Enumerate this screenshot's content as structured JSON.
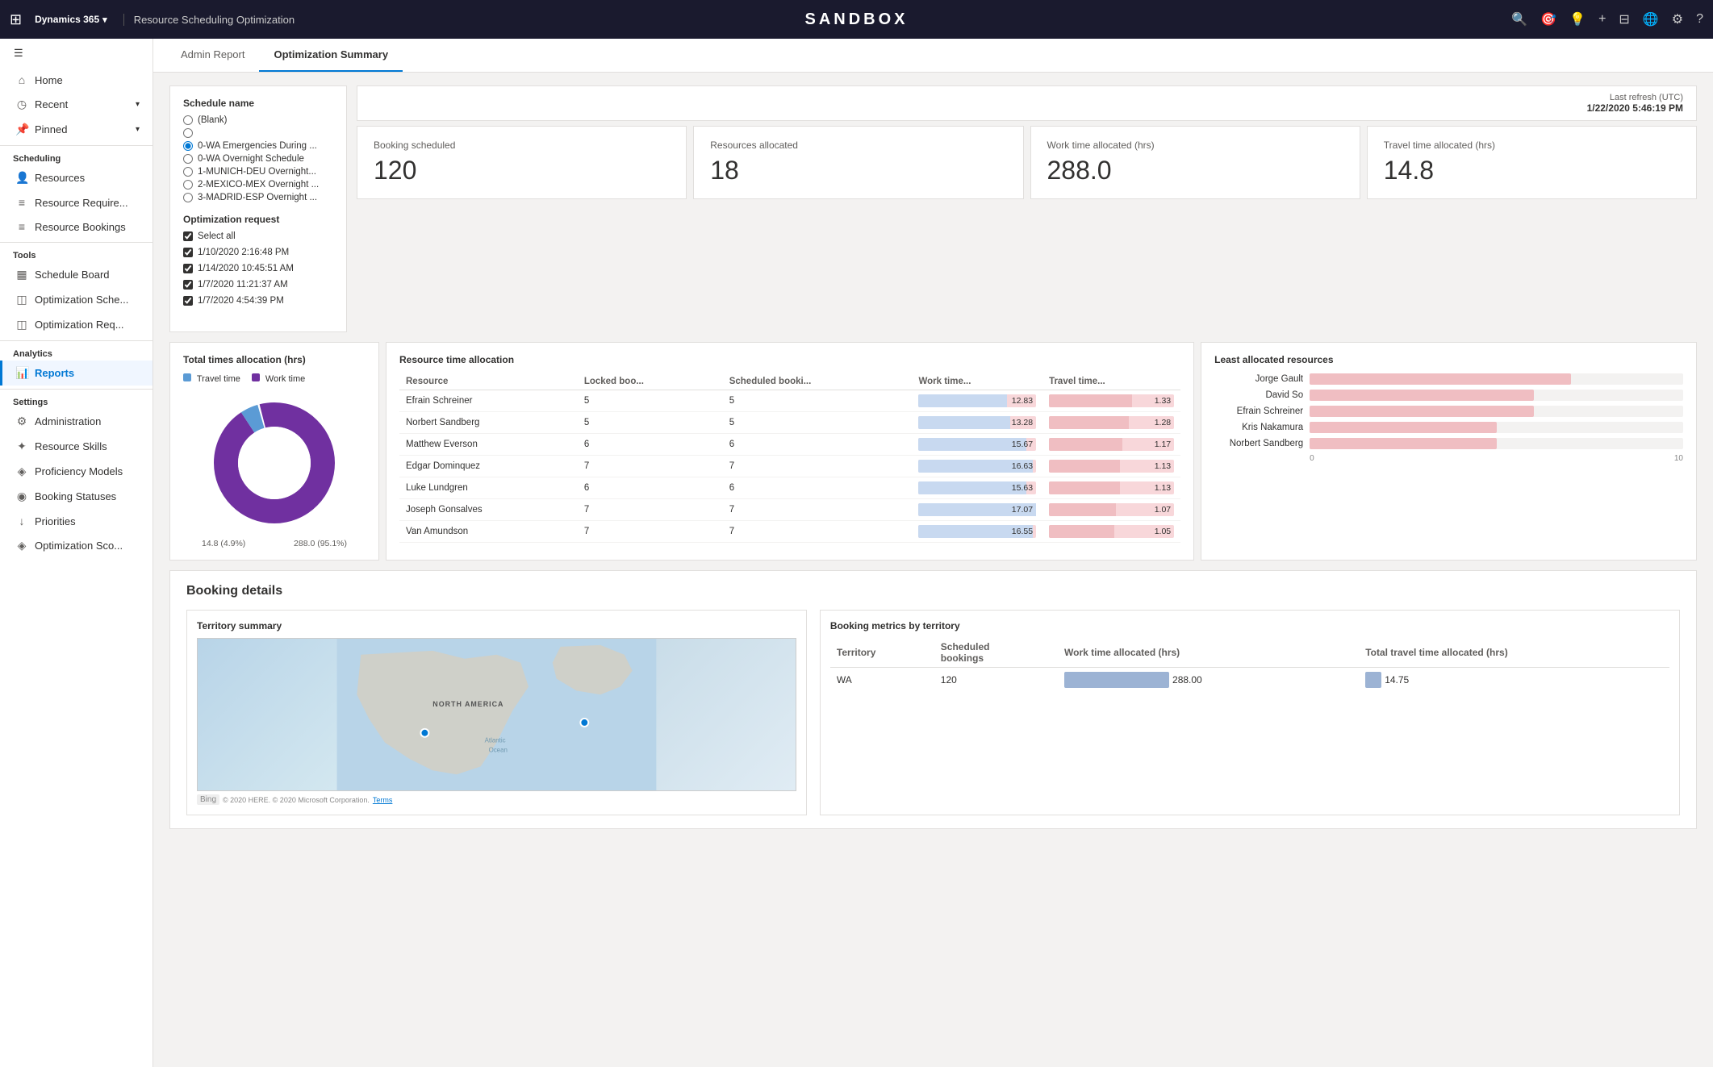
{
  "topbar": {
    "apps_icon": "⊞",
    "app_name": "Dynamics 365",
    "chevron": "▾",
    "page_title": "Resource Scheduling Optimization",
    "center_logo": "SANDBOX",
    "icons": {
      "search": "🔍",
      "target": "🎯",
      "lightbulb": "💡",
      "plus": "+",
      "filter": "⊟",
      "globe": "🌐",
      "settings": "⚙",
      "help": "?"
    }
  },
  "tabs": [
    {
      "id": "admin",
      "label": "Admin Report",
      "active": false
    },
    {
      "id": "optimization",
      "label": "Optimization Summary",
      "active": true
    }
  ],
  "sidebar": {
    "collapse_icon": "☰",
    "sections": [
      {
        "items": [
          {
            "id": "home",
            "label": "Home",
            "icon": "⌂",
            "active": false
          },
          {
            "id": "recent",
            "label": "Recent",
            "icon": "◷",
            "active": false,
            "expand": "▾"
          },
          {
            "id": "pinned",
            "label": "Pinned",
            "icon": "📌",
            "active": false,
            "expand": "▾"
          }
        ]
      },
      {
        "label": "Scheduling",
        "items": [
          {
            "id": "resources",
            "label": "Resources",
            "icon": "👤",
            "active": false
          },
          {
            "id": "resource-req",
            "label": "Resource Require...",
            "icon": "≡",
            "active": false
          },
          {
            "id": "resource-bookings",
            "label": "Resource Bookings",
            "icon": "≡",
            "active": false
          }
        ]
      },
      {
        "label": "Tools",
        "items": [
          {
            "id": "schedule-board",
            "label": "Schedule Board",
            "icon": "▦",
            "active": false
          },
          {
            "id": "opt-schedule",
            "label": "Optimization Sche...",
            "icon": "◫",
            "active": false
          },
          {
            "id": "opt-req",
            "label": "Optimization Req...",
            "icon": "◫",
            "active": false
          }
        ]
      },
      {
        "label": "Analytics",
        "items": [
          {
            "id": "reports",
            "label": "Reports",
            "icon": "📊",
            "active": true
          }
        ]
      },
      {
        "label": "Settings",
        "items": [
          {
            "id": "administration",
            "label": "Administration",
            "icon": "⚙",
            "active": false
          },
          {
            "id": "resource-skills",
            "label": "Resource Skills",
            "icon": "✦",
            "active": false
          },
          {
            "id": "proficiency",
            "label": "Proficiency Models",
            "icon": "◈",
            "active": false
          },
          {
            "id": "booking-statuses",
            "label": "Booking Statuses",
            "icon": "◉",
            "active": false
          },
          {
            "id": "priorities",
            "label": "Priorities",
            "icon": "↓",
            "active": false
          },
          {
            "id": "opt-score",
            "label": "Optimization Sco...",
            "icon": "◈",
            "active": false
          }
        ]
      }
    ]
  },
  "last_refresh": {
    "label": "Last refresh (UTC)",
    "value": "1/22/2020 5:46:19 PM"
  },
  "schedule_name": {
    "label": "Schedule name",
    "options": [
      {
        "label": "(Blank)",
        "selected": false
      },
      {
        "label": "",
        "selected": false
      },
      {
        "label": "0-WA Emergencies During ...",
        "selected": true
      },
      {
        "label": "0-WA Overnight Schedule",
        "selected": false
      },
      {
        "label": "1-MUNICH-DEU Overnight...",
        "selected": false
      },
      {
        "label": "2-MEXICO-MEX Overnight ...",
        "selected": false
      },
      {
        "label": "3-MADRID-ESP Overnight ...",
        "selected": false
      }
    ]
  },
  "optimization_request": {
    "label": "Optimization request",
    "select_all": "Select all",
    "items": [
      {
        "label": "1/10/2020 2:16:48 PM"
      },
      {
        "label": "1/14/2020 10:45:51 AM"
      },
      {
        "label": "1/7/2020 11:21:37 AM"
      },
      {
        "label": "1/7/2020 4:54:39 PM"
      }
    ]
  },
  "kpi": {
    "booking_scheduled": {
      "label": "Booking scheduled",
      "value": "120"
    },
    "resources_allocated": {
      "label": "Resources allocated",
      "value": "18"
    },
    "work_time_allocated": {
      "label": "Work time allocated (hrs)",
      "value": "288.0"
    },
    "travel_time_allocated": {
      "label": "Travel time allocated (hrs)",
      "value": "14.8"
    }
  },
  "total_times": {
    "title": "Total times allocation (hrs)",
    "travel_label": "Travel time",
    "work_label": "Work time",
    "travel_value": 14.8,
    "work_value": 288.0,
    "travel_pct": "14.8 (4.9%)",
    "work_pct": "288.0 (95.1%)",
    "travel_color": "#5b9bd5",
    "work_color": "#7030a0"
  },
  "resource_time_allocation": {
    "title": "Resource time allocation",
    "columns": [
      "Resource",
      "Locked boo...",
      "Scheduled booki...",
      "Work time...",
      "Travel time..."
    ],
    "rows": [
      {
        "name": "Efrain Schreiner",
        "locked": 5,
        "scheduled": 5,
        "work": 12.83,
        "travel": 1.33
      },
      {
        "name": "Norbert Sandberg",
        "locked": 5,
        "scheduled": 5,
        "work": 13.28,
        "travel": 1.28
      },
      {
        "name": "Matthew Everson",
        "locked": 6,
        "scheduled": 6,
        "work": 15.67,
        "travel": 1.17
      },
      {
        "name": "Edgar Dominquez",
        "locked": 7,
        "scheduled": 7,
        "work": 16.63,
        "travel": 1.13
      },
      {
        "name": "Luke Lundgren",
        "locked": 6,
        "scheduled": 6,
        "work": 15.63,
        "travel": 1.13
      },
      {
        "name": "Joseph Gonsalves",
        "locked": 7,
        "scheduled": 7,
        "work": 17.07,
        "travel": 1.07
      },
      {
        "name": "Van Amundson",
        "locked": 7,
        "scheduled": 7,
        "work": 16.55,
        "travel": 1.05
      }
    ]
  },
  "least_allocated": {
    "title": "Least allocated resources",
    "rows": [
      {
        "name": "Jorge Gault",
        "value": 7
      },
      {
        "name": "David So",
        "value": 6
      },
      {
        "name": "Efrain Schreiner",
        "value": 6
      },
      {
        "name": "Kris Nakamura",
        "value": 5
      },
      {
        "name": "Norbert Sandberg",
        "value": 5
      }
    ],
    "axis": [
      "0",
      "10"
    ]
  },
  "booking_details": {
    "title": "Booking details",
    "territory_summary": {
      "title": "Territory summary",
      "map_label": "NORTH AMERICA",
      "bing_label": "Bing",
      "copyright": "© 2020 HERE. © 2020 Microsoft Corporation.",
      "terms": "Terms",
      "dots": [
        {
          "left": "28%",
          "top": "62%"
        },
        {
          "left": "78%",
          "top": "52%"
        }
      ]
    },
    "booking_metrics": {
      "title": "Booking metrics by territory",
      "columns": [
        "Territory",
        "Scheduled bookings",
        "Work time allocated (hrs)",
        "Total travel time allocated (hrs)"
      ],
      "rows": [
        {
          "territory": "WA",
          "scheduled": 120,
          "work": 288.0,
          "travel": 14.75
        }
      ]
    }
  }
}
